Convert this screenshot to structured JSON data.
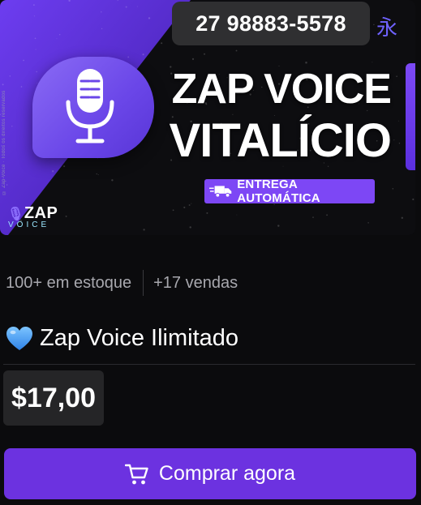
{
  "banner": {
    "phone": "27 98883-5578",
    "corner_glyph": "永",
    "title_line1": "ZAP VOICE",
    "title_line2": "VITALÍCIO",
    "delivery_badge": "ENTREGA AUTOMÁTICA",
    "logo_top": "ZAP",
    "logo_bottom": "VOICE",
    "side_copyright": "© Zap Voice · Todos os direitos reservados",
    "icons": [
      "microphone-icon",
      "delivery-truck-icon"
    ],
    "colors": {
      "accent": "#7d47f5",
      "brand_purple": "#6a46e8"
    }
  },
  "stats": {
    "stock": "100+ em estoque",
    "sales": "+17 vendas"
  },
  "product": {
    "emoji": "💙",
    "title": "Zap Voice Ilimitado",
    "price": "$17,00"
  },
  "actions": {
    "buy_label": "Comprar agora",
    "buy_icon": "cart-icon",
    "button_color": "#6c32e0"
  }
}
